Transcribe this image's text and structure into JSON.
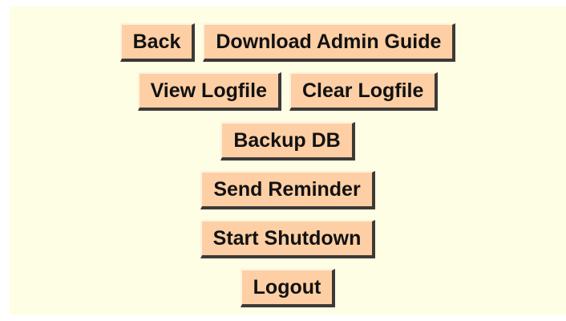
{
  "admin_menu": {
    "row1": {
      "back": "Back",
      "download_guide": "Download Admin Guide"
    },
    "row2": {
      "view_logfile": "View Logfile",
      "clear_logfile": "Clear Logfile"
    },
    "row3": {
      "backup_db": "Backup DB"
    },
    "row4": {
      "send_reminder": "Send Reminder"
    },
    "row5": {
      "start_shutdown": "Start Shutdown"
    },
    "row6": {
      "logout": "Logout"
    }
  },
  "colors": {
    "page_background": "#ffffff",
    "panel_background": "#fefee4",
    "button_face": "#fecfa4",
    "button_shadow": "#3c3a37",
    "button_text": "#111111"
  }
}
